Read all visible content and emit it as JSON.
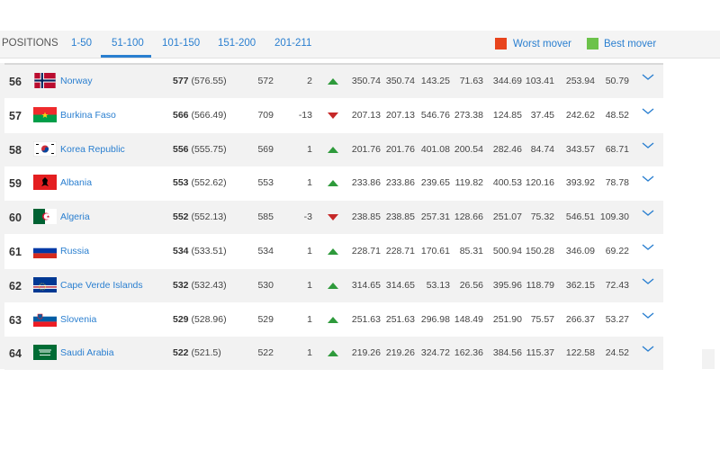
{
  "tabs": {
    "positions_label": "POSITIONS",
    "items": [
      "1-50",
      "51-100",
      "101-150",
      "151-200",
      "201-211"
    ],
    "active": "51-100"
  },
  "legend": {
    "worst_label": "Worst mover",
    "worst_color": "#e8441c",
    "best_label": "Best mover",
    "best_color": "#6cc24a"
  },
  "rows": [
    {
      "rank": "56",
      "team": "Norway",
      "points": "577",
      "points_exact": "(576.55)",
      "prev_points": "572",
      "change": "2",
      "trend": "up",
      "v": [
        "350.74",
        "350.74",
        "143.25",
        "71.63",
        "344.69",
        "103.41",
        "253.94",
        "50.79"
      ]
    },
    {
      "rank": "57",
      "team": "Burkina Faso",
      "points": "566",
      "points_exact": "(566.49)",
      "prev_points": "709",
      "change": "-13",
      "trend": "down",
      "v": [
        "207.13",
        "207.13",
        "546.76",
        "273.38",
        "124.85",
        "37.45",
        "242.62",
        "48.52"
      ]
    },
    {
      "rank": "58",
      "team": "Korea Republic",
      "points": "556",
      "points_exact": "(555.75)",
      "prev_points": "569",
      "change": "1",
      "trend": "up",
      "v": [
        "201.76",
        "201.76",
        "401.08",
        "200.54",
        "282.46",
        "84.74",
        "343.57",
        "68.71"
      ]
    },
    {
      "rank": "59",
      "team": "Albania",
      "points": "553",
      "points_exact": "(552.62)",
      "prev_points": "553",
      "change": "1",
      "trend": "up",
      "v": [
        "233.86",
        "233.86",
        "239.65",
        "119.82",
        "400.53",
        "120.16",
        "393.92",
        "78.78"
      ]
    },
    {
      "rank": "60",
      "team": "Algeria",
      "points": "552",
      "points_exact": "(552.13)",
      "prev_points": "585",
      "change": "-3",
      "trend": "down",
      "v": [
        "238.85",
        "238.85",
        "257.31",
        "128.66",
        "251.07",
        "75.32",
        "546.51",
        "109.30"
      ]
    },
    {
      "rank": "61",
      "team": "Russia",
      "points": "534",
      "points_exact": "(533.51)",
      "prev_points": "534",
      "change": "1",
      "trend": "up",
      "v": [
        "228.71",
        "228.71",
        "170.61",
        "85.31",
        "500.94",
        "150.28",
        "346.09",
        "69.22"
      ]
    },
    {
      "rank": "62",
      "team": "Cape Verde Islands",
      "points": "532",
      "points_exact": "(532.43)",
      "prev_points": "530",
      "change": "1",
      "trend": "up",
      "v": [
        "314.65",
        "314.65",
        "53.13",
        "26.56",
        "395.96",
        "118.79",
        "362.15",
        "72.43"
      ]
    },
    {
      "rank": "63",
      "team": "Slovenia",
      "points": "529",
      "points_exact": "(528.96)",
      "prev_points": "529",
      "change": "1",
      "trend": "up",
      "v": [
        "251.63",
        "251.63",
        "296.98",
        "148.49",
        "251.90",
        "75.57",
        "266.37",
        "53.27"
      ]
    },
    {
      "rank": "64",
      "team": "Saudi Arabia",
      "points": "522",
      "points_exact": "(521.5)",
      "prev_points": "522",
      "change": "1",
      "trend": "up",
      "v": [
        "219.26",
        "219.26",
        "324.72",
        "162.36",
        "384.56",
        "115.37",
        "122.58",
        "24.52"
      ]
    }
  ]
}
